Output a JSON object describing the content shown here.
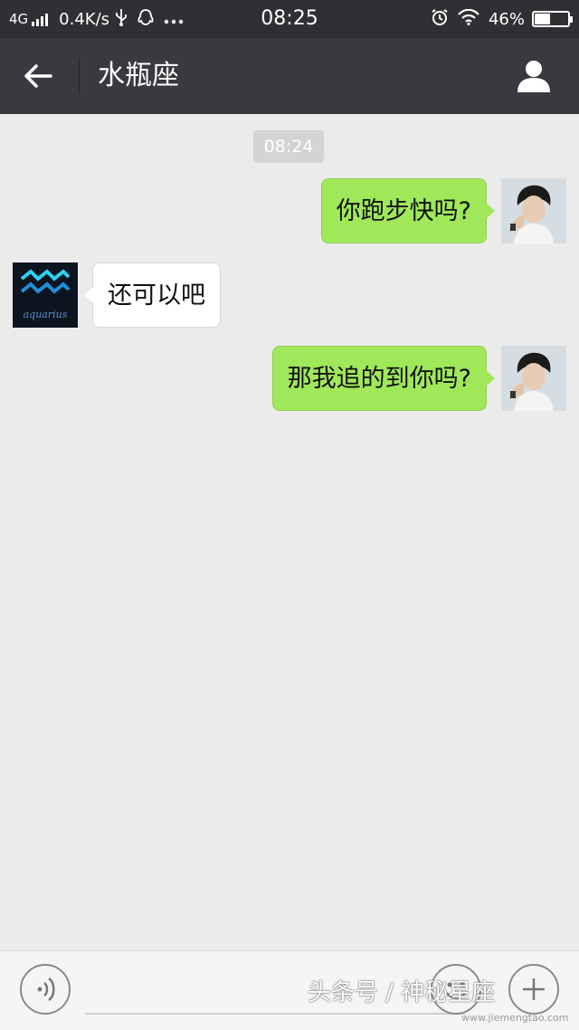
{
  "status_bar": {
    "network": "4G",
    "speed": "0.4K/s",
    "time": "08:25",
    "battery": "46%",
    "battery_level": 0.46,
    "icons": [
      "usb-icon",
      "qq-icon",
      "more-dots-icon",
      "alarm-icon",
      "wifi-icon"
    ]
  },
  "header": {
    "title": "水瓶座",
    "back_icon": "back-arrow-icon",
    "profile_icon": "person-icon"
  },
  "chat": {
    "timestamp": "08:24",
    "messages": [
      {
        "direction": "out",
        "text": "你跑步快吗?"
      },
      {
        "direction": "in",
        "text": "还可以吧",
        "avatar_text": "aquarius"
      },
      {
        "direction": "out",
        "text": "那我追的到你吗?"
      }
    ]
  },
  "input_bar": {
    "voice_icon": "voice-icon",
    "emoji_icon": "emoji-icon",
    "more_icon": "plus-icon"
  },
  "watermark": {
    "text": "头条号 / 神秘星座",
    "url": "www.jiemengtao.com"
  },
  "colors": {
    "header_bg": "#393a3f",
    "chat_bg": "#ebebeb",
    "bubble_out": "#a0e75a",
    "bubble_in": "#ffffff"
  }
}
